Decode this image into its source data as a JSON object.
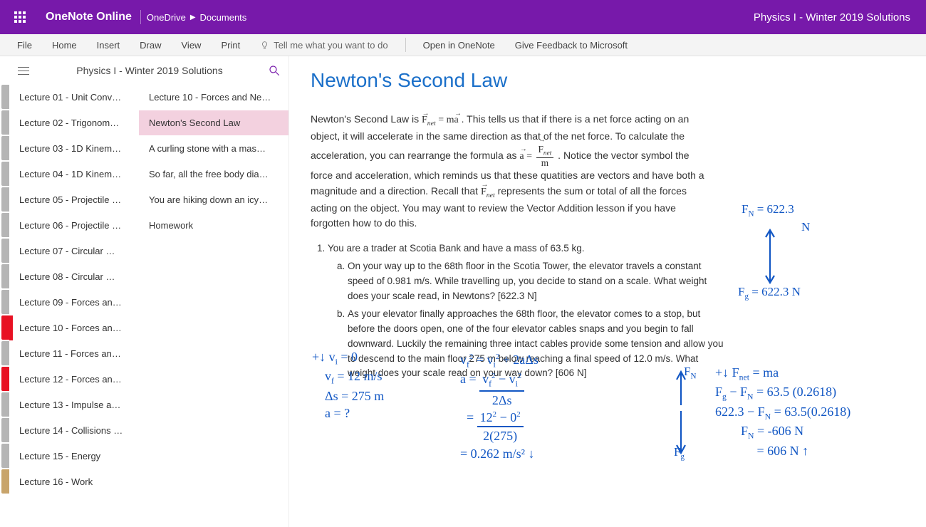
{
  "header": {
    "app_name": "OneNote Online",
    "breadcrumb_root": "OneDrive",
    "breadcrumb_leaf": "Documents",
    "doc_title": "Physics I - Winter 2019 Solutions"
  },
  "ribbon": {
    "tabs": [
      "File",
      "Home",
      "Insert",
      "Draw",
      "View",
      "Print"
    ],
    "tell_me_placeholder": "Tell me what you want to do",
    "open_in": "Open in OneNote",
    "feedback": "Give Feedback to Microsoft"
  },
  "nav": {
    "notebook_title": "Physics I - Winter 2019 Solutions",
    "rail_colors": [
      "#b5b5b5",
      "#b5b5b5",
      "#b5b5b5",
      "#b5b5b5",
      "#b5b5b5",
      "#b5b5b5",
      "#b5b5b5",
      "#b5b5b5",
      "#b5b5b5",
      "#e81123",
      "#b5b5b5",
      "#e81123",
      "#b5b5b5",
      "#b5b5b5",
      "#b5b5b5",
      "#c8a46b"
    ],
    "sections": [
      "Lecture 01 - Unit Conv…",
      "Lecture 02 - Trigonom…",
      "Lecture 03 - 1D Kinem…",
      "Lecture 04 - 1D Kinem…",
      "Lecture 05 - Projectile …",
      "Lecture 06 - Projectile …",
      "Lecture 07 - Circular …",
      "Lecture 08 - Circular …",
      "Lecture 09 - Forces an…",
      "Lecture 10 - Forces an…",
      "Lecture 11 - Forces an…",
      "Lecture 12 - Forces an…",
      "Lecture 13 - Impulse a…",
      "Lecture 14 - Collisions …",
      "Lecture 15 - Energy",
      "Lecture 16 - Work"
    ],
    "selected_section_index": 9,
    "pages": [
      "Lecture 10 - Forces and Ne…",
      "Newton's Second Law",
      "A curling stone with a mas…",
      "So far, all the free body dia…",
      "You are hiking down an icy…",
      "Homework"
    ],
    "selected_page_index": 1
  },
  "page": {
    "title": "Newton's Second Law",
    "intro_1a": "Newton's Second Law is ",
    "intro_1b": ". This tells us that if there is a net force acting on an object, it will accelerate in the same direction as that of the net force. To calculate the acceleration, you can rearrange the formula as ",
    "intro_1c": ".  Notice the vector symbol the force and acceleration, which reminds us that these quatities are vectors and have both a magnitude and a direction. Recall that ",
    "intro_1d": " represents the sum or total of all the forces acting on the object. You may want to review the Vector Addition lesson if you have forgotten how to do this.",
    "problem_1_stem": "You are a trader at Scotia Bank and have a mass of 63.5 kg.",
    "problem_1a": "On your way up to the 68th floor in the Scotia Tower, the elevator travels a constant speed of 0.981 m/s. While travelling up, you decide to stand on a scale. What weight does your scale read, in Newtons? [622.3 N]",
    "problem_1b": "As your elevator finally approaches the 68th floor, the elevator comes to a stop, but before the doors open, one of the four elevator cables snaps and you begin to fall downward. Luckily the remaining three intact cables provide some tension and allow you to descend to the main floor 275 m below reaching a final speed of 12.0 m/s. What weight does your scale read on your way down? [606 N]"
  },
  "ink": {
    "fn_top": "F_N = 622.3 N",
    "fg_top": "F_g = 622.3 N",
    "plus_down": "+↓",
    "vi": "v_i = 0",
    "vf": "v_f = 12 m/s",
    "ds": "Δs = 275 m",
    "aq": "a = ?",
    "kin_eq": "v_f² = v_i² + 2aΔs",
    "a_frac_num": "v_f² − v_i²",
    "a_frac_den": "2Δs",
    "a_plug_num": "12² − 0²",
    "a_plug_den": "2(275)",
    "a_result": "= 0.262 m/s² ↓",
    "fn_label": "F_N",
    "fg_label": "F_g",
    "fnet_eq": "+↓ F_net = ma",
    "line2": "F_g − F_N = 63.5 (0.2618)",
    "line3": "622.3 − F_N = 63.5(0.2618)",
    "line4": "F_N = -606 N",
    "line5": "= 606 N ↑"
  }
}
